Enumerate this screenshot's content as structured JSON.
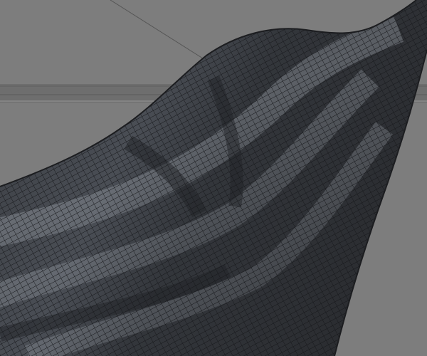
{
  "viewport": {
    "background_color": "#7d7d7d",
    "horizon_color": "#6a6a6a",
    "mesh_color": "#3c3f44",
    "wire_color": "#1a1b1d",
    "highlight_color": "#9aa0a8"
  }
}
